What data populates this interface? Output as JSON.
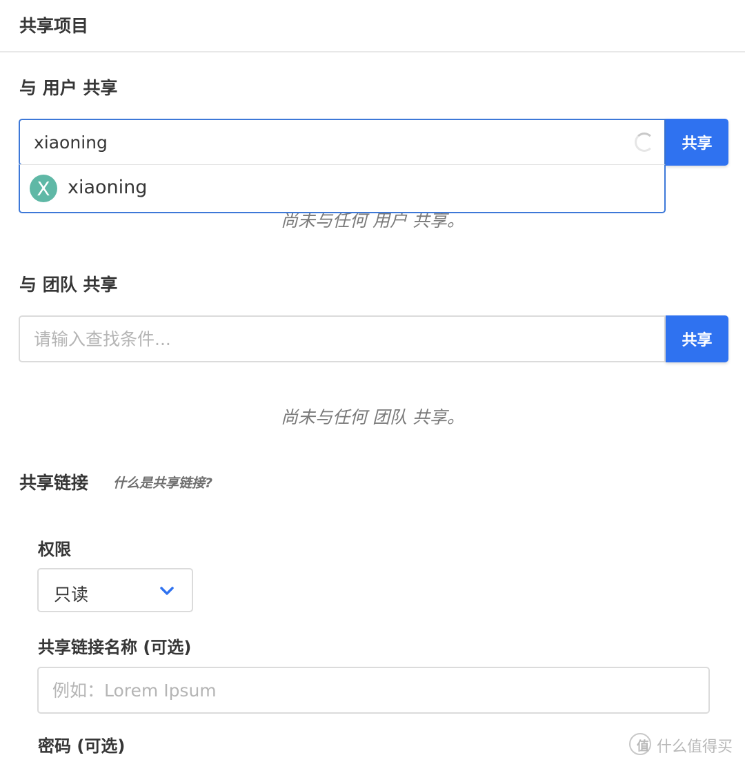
{
  "header": {
    "title": "共享项目"
  },
  "user_share": {
    "title": "与 用户 共享",
    "input_value": "xiaoning",
    "button_label": "共享",
    "suggestions": [
      {
        "initial": "X",
        "name": "xiaoning"
      }
    ],
    "empty_note": "尚未与任何 用户 共享。"
  },
  "team_share": {
    "title": "与 团队 共享",
    "input_placeholder": "请输入查找条件...",
    "button_label": "共享",
    "empty_note": "尚未与任何 团队 共享。"
  },
  "share_link": {
    "title": "共享链接",
    "help_link": "什么是共享链接?",
    "permission_label": "权限",
    "permission_value": "只读",
    "name_label": "共享链接名称 (可选)",
    "name_placeholder": "例如：Lorem Ipsum",
    "password_label": "密码 (可选)"
  },
  "watermark": {
    "icon_char": "值",
    "text": "什么值得买"
  },
  "colors": {
    "accent": "#2f72f0",
    "focus_border": "#3d78d8",
    "avatar": "#5fb8a6"
  }
}
